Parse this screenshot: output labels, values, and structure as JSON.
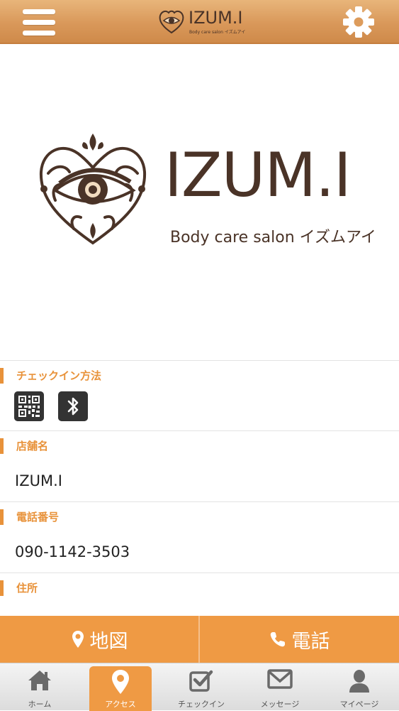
{
  "header": {
    "brand": "IZUM.I",
    "tagline": "Body care salon イズムアイ"
  },
  "hero": {
    "brand": "IZUM.I",
    "tagline": "Body care salon イズムアイ"
  },
  "sections": {
    "checkin": {
      "label": "チェックイン方法"
    },
    "store": {
      "label": "店舗名",
      "value": "IZUM.I"
    },
    "phone": {
      "label": "電話番号",
      "value": "090-1142-3503"
    },
    "address": {
      "label": "住所"
    }
  },
  "actions": {
    "map_label": "地図",
    "call_label": "電話"
  },
  "tabs": [
    {
      "label": "ホーム",
      "icon": "home-icon"
    },
    {
      "label": "アクセス",
      "icon": "map-pin-icon"
    },
    {
      "label": "チェックイン",
      "icon": "checkbox-icon"
    },
    {
      "label": "メッセージ",
      "icon": "envelope-icon"
    },
    {
      "label": "マイページ",
      "icon": "user-icon"
    }
  ],
  "colors": {
    "accent": "#ef9a44",
    "label": "#e8923a",
    "brand_text": "#4a3327"
  }
}
